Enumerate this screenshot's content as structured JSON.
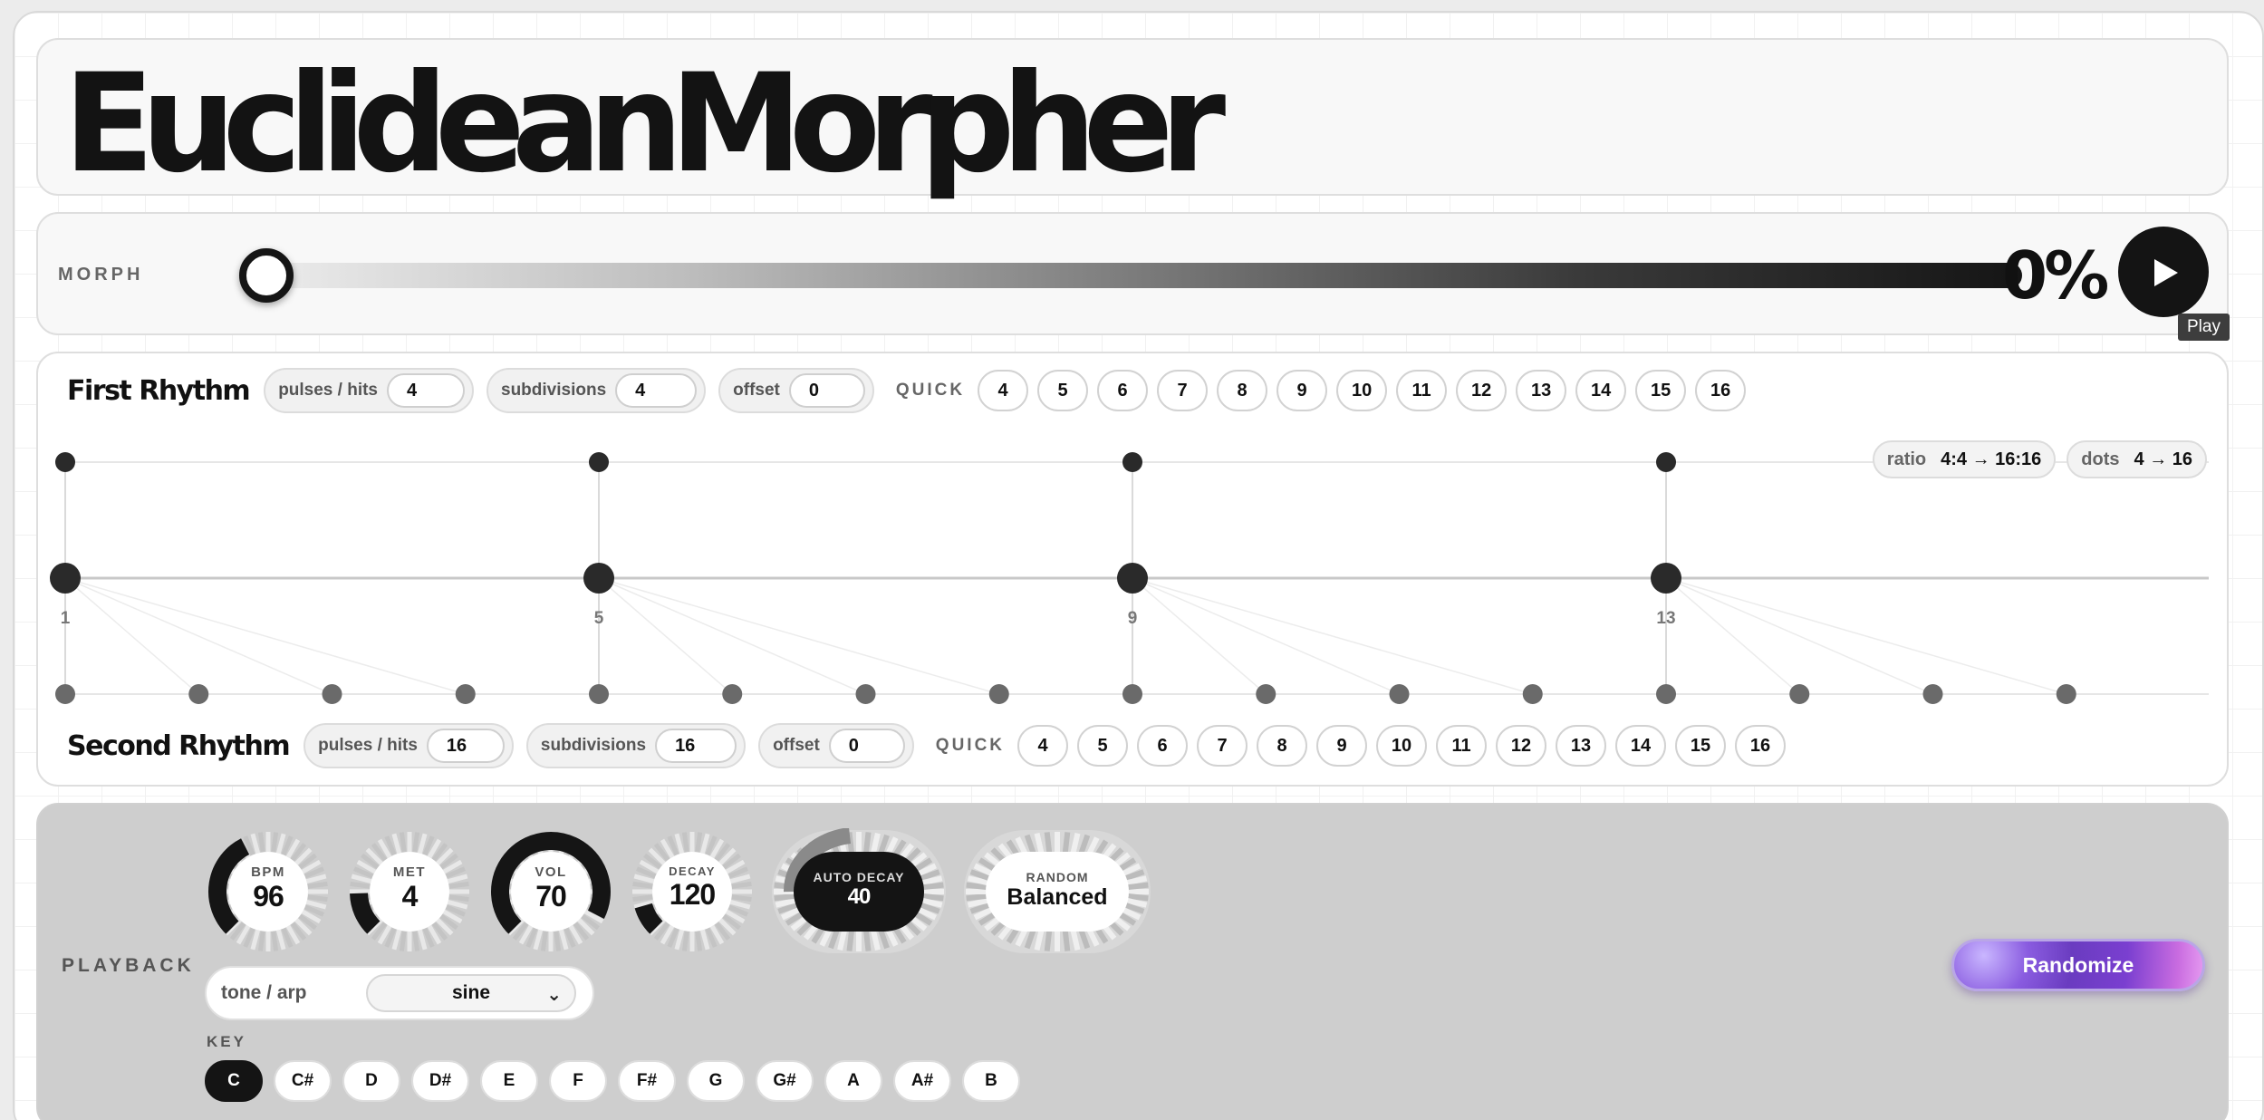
{
  "app": {
    "title": "EuclideanMorpher"
  },
  "morph": {
    "label": "MORPH",
    "value_text": "0%",
    "value": 0,
    "play_tooltip": "Play"
  },
  "first_rhythm": {
    "title": "First Rhythm",
    "pulses_label": "pulses / hits",
    "pulses": "4",
    "subdivisions_label": "subdivisions",
    "subdivisions": "4",
    "offset_label": "offset",
    "offset": "0",
    "quick_label": "QUICK",
    "quick": [
      "4",
      "5",
      "6",
      "7",
      "8",
      "9",
      "10",
      "11",
      "12",
      "13",
      "14",
      "15",
      "16"
    ]
  },
  "second_rhythm": {
    "title": "Second Rhythm",
    "pulses_label": "pulses / hits",
    "pulses": "16",
    "subdivisions_label": "subdivisions",
    "subdivisions": "16",
    "offset_label": "offset",
    "offset": "0",
    "quick_label": "QUICK",
    "quick": [
      "4",
      "5",
      "6",
      "7",
      "8",
      "9",
      "10",
      "11",
      "12",
      "13",
      "14",
      "15",
      "16"
    ]
  },
  "visualization": {
    "ratio_label": "ratio",
    "ratio_value": "4:4 → 16:16",
    "dots_label": "dots",
    "dots_value": "4 → 16",
    "beat_labels": [
      "1",
      "5",
      "9",
      "13"
    ],
    "first_steps": 4,
    "second_steps": 16
  },
  "playback": {
    "label": "PLAYBACK",
    "knobs": {
      "bpm": {
        "label": "BPM",
        "value": "96",
        "level": 0.3
      },
      "met": {
        "label": "MET",
        "value": "4",
        "level": 0.12
      },
      "vol": {
        "label": "VOL",
        "value": "70",
        "level": 0.7
      },
      "decay": {
        "label": "DECAY",
        "value": "120",
        "level": 0.08
      },
      "auto_decay": {
        "label": "AUTO DECAY",
        "value": "40"
      },
      "random": {
        "label": "RANDOM",
        "value": "Balanced"
      }
    },
    "tone_label": "tone / arp",
    "tone_value": "sine",
    "key_label": "KEY",
    "keys": [
      "C",
      "C#",
      "D",
      "D#",
      "E",
      "F",
      "F#",
      "G",
      "G#",
      "A",
      "A#",
      "B"
    ],
    "active_key": "C",
    "randomize_label": "Randomize"
  },
  "colors": {
    "ink": "#141414",
    "accent_purple": "#7a3fd0",
    "panel_grey": "#cecece"
  }
}
